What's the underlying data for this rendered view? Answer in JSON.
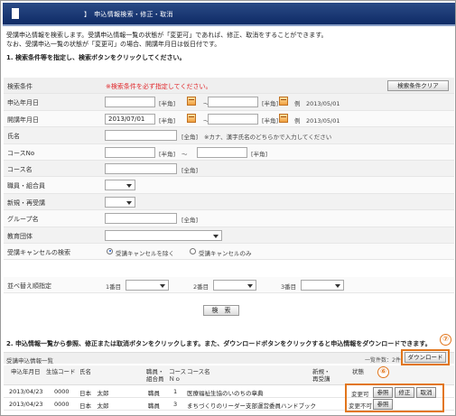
{
  "header": {
    "title": "】　申込情報検索・修正・取消"
  },
  "intro": {
    "line1": "受講申込情報を検索します。受講申込情報一覧の状態が「変更可」であれば、修正、取消をすることができます。",
    "line2": "なお、受講申込一覧の状態が「変更可」の場合、開講年月日は仮日付です。"
  },
  "step1": "1. 検索条件等を指定し、検索ボタンをクリックしてください。",
  "form": {
    "condition_label": "検索条件",
    "condition_warning": "※検索条件を必ず指定してください。",
    "clear_button": "検索条件クリア",
    "apply_date": {
      "label": "申込年月日",
      "from": "",
      "to": "",
      "hint_half": "[半角]",
      "tilde": "～",
      "example": "例　2013/05/01"
    },
    "open_date": {
      "label": "開講年月日",
      "from": "2013/07/01",
      "to": "",
      "hint_half": "[半角]",
      "tilde": "～",
      "example": "例　2013/05/01"
    },
    "name": {
      "label": "氏名",
      "value": "",
      "hint": "[全角]",
      "note": "※カナ、漢字氏名のどちらかで入力してください"
    },
    "course_no": {
      "label": "コースNo",
      "from": "",
      "to": "",
      "hint_half": "[半角]",
      "tilde": "～"
    },
    "course_name": {
      "label": "コース名",
      "value": "",
      "hint": "[全角]"
    },
    "position": {
      "label": "職員・組合員",
      "value": ""
    },
    "new_re": {
      "label": "新規・再受講",
      "value": ""
    },
    "group": {
      "label": "グループ名",
      "value": "",
      "hint": "[全角]"
    },
    "edu_org": {
      "label": "教育団体",
      "value": ""
    },
    "cancel_search": {
      "label": "受講キャンセルの検索",
      "option1": "受講キャンセルを除く",
      "option2": "受講キャンセルのみ",
      "selected": "option1"
    },
    "sort": {
      "label": "並べ替え順指定",
      "first": "1番目",
      "second": "2番目",
      "third": "3番目"
    },
    "search_button": "検　索"
  },
  "step2": "2. 申込情報一覧から参照、修正または取消ボタンをクリックします。また、ダウンロードボタンをクリックすると申込情報をダウンロードできます。",
  "callouts": {
    "download": "⑦",
    "actions": "⑥"
  },
  "list": {
    "title": "受講申込情報一覧",
    "count": "一覧件数：2件",
    "download_button": "ダウンロード",
    "headers": {
      "apply_date": "申込年月日",
      "member_code": "生協コード",
      "name": "氏名",
      "position": "職員・\n組合員",
      "course_no": "コース\nＮｏ",
      "course_name": "コース名",
      "new_re": "新規・\n再受講",
      "status": "状態"
    },
    "rows": [
      {
        "apply_date": "2013/04/23",
        "member_code": "0000",
        "name": "日本　太郎",
        "position": "職員",
        "course_no": "1",
        "course_name": "医療福祉生協のいのちの章典",
        "new_re": "",
        "status": "変更可",
        "ref": "参照",
        "edit": "修正",
        "cancel": "取消"
      },
      {
        "apply_date": "2013/04/23",
        "member_code": "0000",
        "name": "日本　太郎",
        "position": "職員",
        "course_no": "3",
        "course_name": "まちづくりのリーダー支部運営委員ハンドブック",
        "new_re": "",
        "status": "変更不可",
        "ref": "参照"
      }
    ]
  }
}
